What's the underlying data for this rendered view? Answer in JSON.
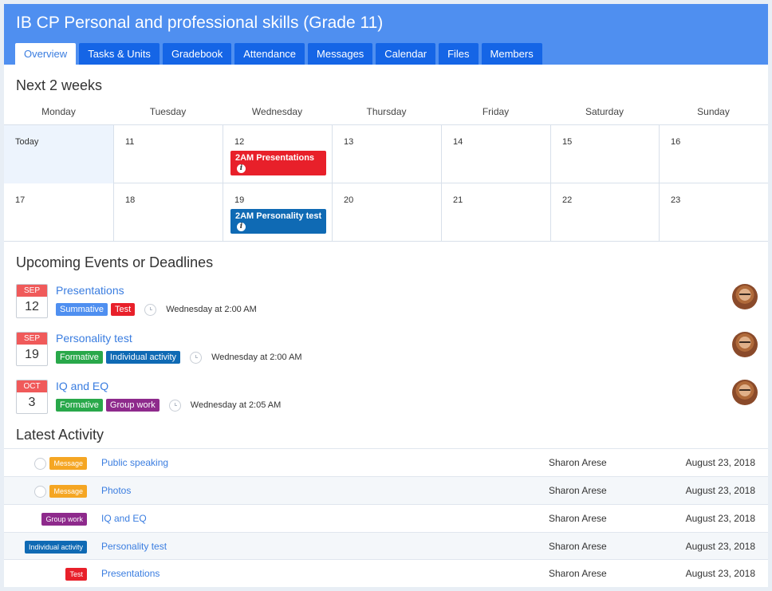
{
  "course": {
    "title": "IB CP Personal and professional skills (Grade 11)"
  },
  "tabs": [
    "Overview",
    "Tasks & Units",
    "Gradebook",
    "Attendance",
    "Messages",
    "Calendar",
    "Files",
    "Members"
  ],
  "active_tab": "Overview",
  "calendar": {
    "title": "Next 2 weeks",
    "weekdays": [
      "Monday",
      "Tuesday",
      "Wednesday",
      "Thursday",
      "Friday",
      "Saturday",
      "Sunday"
    ],
    "weeks": [
      {
        "days": [
          "Today",
          "11",
          "12",
          "13",
          "14",
          "15",
          "16"
        ]
      },
      {
        "days": [
          "17",
          "18",
          "19",
          "20",
          "21",
          "22",
          "23"
        ]
      }
    ],
    "events": [
      {
        "label": "2AM Presentations",
        "color": "#e8202a"
      },
      {
        "label": "2AM Personality test",
        "color": "#0f6ab4"
      }
    ]
  },
  "upcoming": {
    "title": "Upcoming Events or Deadlines",
    "items": [
      {
        "month": "SEP",
        "day": "12",
        "title": "Presentations",
        "tags": [
          {
            "label": "Summative",
            "color": "#4f8ff0"
          },
          {
            "label": "Test",
            "color": "#e8202a"
          }
        ],
        "time": "Wednesday at 2:00 AM"
      },
      {
        "month": "SEP",
        "day": "19",
        "title": "Personality test",
        "tags": [
          {
            "label": "Formative",
            "color": "#29a84a"
          },
          {
            "label": "Individual activity",
            "color": "#0f6ab4"
          }
        ],
        "time": "Wednesday at 2:00 AM"
      },
      {
        "month": "OCT",
        "day": "3",
        "title": "IQ and EQ",
        "tags": [
          {
            "label": "Formative",
            "color": "#29a84a"
          },
          {
            "label": "Group work",
            "color": "#8e2a8c"
          }
        ],
        "time": "Wednesday at 2:05 AM"
      }
    ]
  },
  "activity": {
    "title": "Latest Activity",
    "rows": [
      {
        "tag": "Message",
        "tag_color": "#f5a623",
        "circle": true,
        "title": "Public speaking",
        "author": "Sharon Arese",
        "date": "August 23, 2018"
      },
      {
        "tag": "Message",
        "tag_color": "#f5a623",
        "circle": true,
        "title": "Photos",
        "author": "Sharon Arese",
        "date": "August 23, 2018"
      },
      {
        "tag": "Group work",
        "tag_color": "#8e2a8c",
        "circle": false,
        "title": "IQ and EQ",
        "author": "Sharon Arese",
        "date": "August 23, 2018"
      },
      {
        "tag": "Individual activity",
        "tag_color": "#0f6ab4",
        "circle": false,
        "title": "Personality test",
        "author": "Sharon Arese",
        "date": "August 23, 2018"
      },
      {
        "tag": "Test",
        "tag_color": "#e8202a",
        "circle": false,
        "title": "Presentations",
        "author": "Sharon Arese",
        "date": "August 23, 2018"
      }
    ]
  }
}
